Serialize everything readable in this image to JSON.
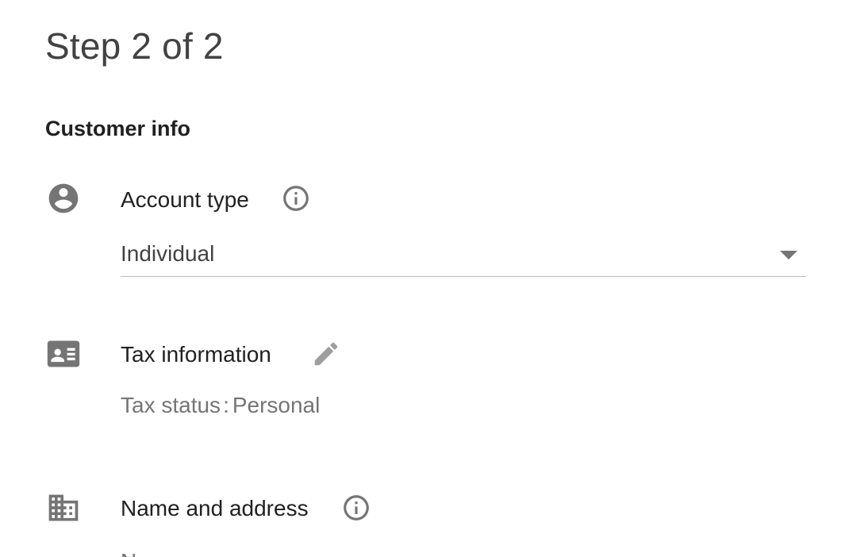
{
  "header": {
    "step_title": "Step 2 of 2"
  },
  "section": {
    "title": "Customer info"
  },
  "account_type": {
    "icon": "account-circle-icon",
    "label": "Account type",
    "info_icon": "info-icon",
    "selected_value": "Individual",
    "dropdown_icon": "arrow-drop-down-icon"
  },
  "tax_information": {
    "icon": "contact-card-icon",
    "label": "Tax information",
    "edit_icon": "pencil-icon",
    "status_label": "Tax status",
    "status_separator": ":",
    "status_value": "Personal"
  },
  "name_and_address": {
    "icon": "business-building-icon",
    "label": "Name and address",
    "info_icon": "info-icon",
    "partial_text": "N"
  },
  "colors": {
    "icon": "#757575",
    "text_primary": "#212121",
    "text_secondary": "#757575",
    "divider": "#bdbdbd"
  }
}
